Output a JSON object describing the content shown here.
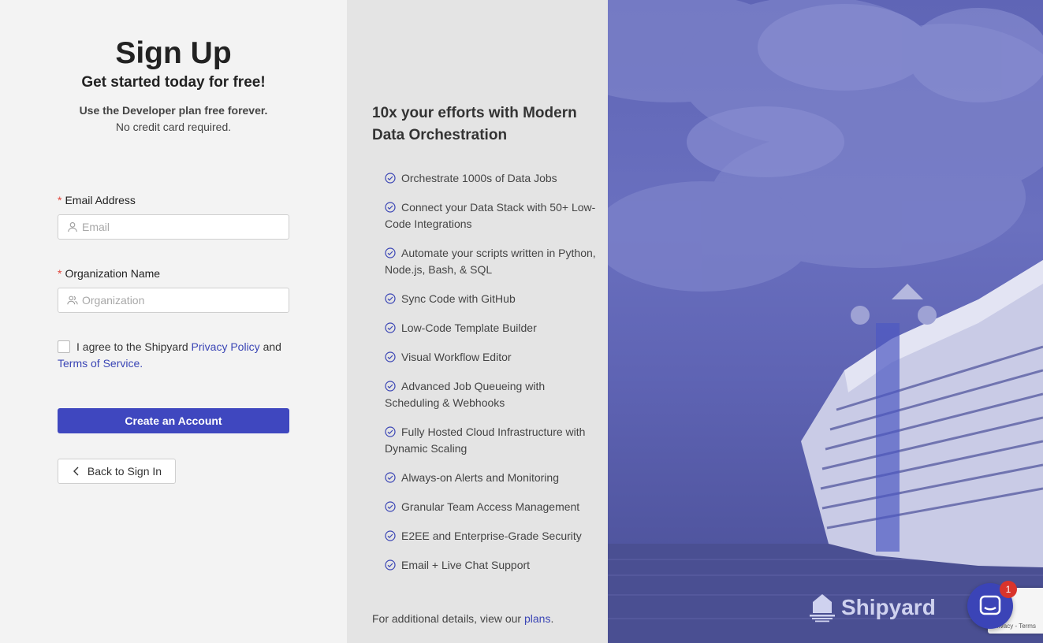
{
  "signup": {
    "title": "Sign Up",
    "subtitle": "Get started today for free!",
    "plan_line": "Use the Developer plan free forever.",
    "credit_line": "No credit card required."
  },
  "form": {
    "email_label": "Email Address",
    "email_placeholder": "Email",
    "org_label": "Organization Name",
    "org_placeholder": "Organization",
    "required_mark": "*",
    "agree_prefix": "I agree to the Shipyard",
    "privacy_link": "Privacy Policy",
    "agree_and": "and",
    "terms_link": "Terms of Service",
    "create_button": "Create an Account",
    "back_button": "Back to Sign In"
  },
  "features": {
    "heading": "10x your efforts with Modern Data Orchestration",
    "items": [
      "Orchestrate 1000s of Data Jobs",
      "Connect your Data Stack with 50+ Low-Code Integrations",
      "Automate your scripts written in Python, Node.js, Bash, & SQL",
      "Sync Code with GitHub",
      "Low-Code Template Builder",
      "Visual Workflow Editor",
      "Advanced Job Queueing with Scheduling & Webhooks",
      "Fully Hosted Cloud Infrastructure with Dynamic Scaling",
      "Always-on Alerts and Monitoring",
      "Granular Team Access Management",
      "E2EE and Enterprise-Grade Security",
      "Email + Live Chat Support"
    ],
    "more_prefix": "For additional details, view our",
    "plans_link": "plans",
    "more_suffix": "."
  },
  "brand": {
    "name": "Shipyard"
  },
  "chat": {
    "badge_count": "1"
  },
  "recaptcha": {
    "text": "Privacy - Terms"
  },
  "colors": {
    "primary": "#3f47bf",
    "link": "#3a45b5",
    "required": "#e0443a",
    "left_bg": "#f3f3f3",
    "middle_bg": "#e4e4e4"
  }
}
